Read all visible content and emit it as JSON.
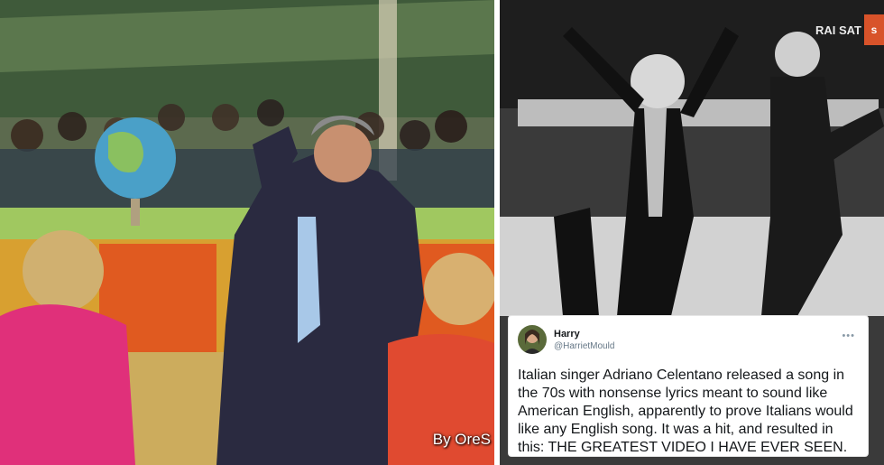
{
  "left_photo": {
    "description_icon": "photo-showman-with-globe",
    "top_caption": "",
    "watermark": "By OreS"
  },
  "right_photo": {
    "description_icon": "photo-dancers-black-and-white",
    "channel_logo_text": "RAI SAT",
    "channel_badge": "s"
  },
  "tweet": {
    "name": "Harry",
    "handle": "@HarrietMould",
    "more_icon": "more-options-icon",
    "text": "Italian singer Adriano Celentano released a song in the 70s with nonsense lyrics meant to sound like American English, apparently to prove Italians would like any English song. It was a hit, and resulted in this: THE GREATEST VIDEO I HAVE EVER SEEN."
  }
}
